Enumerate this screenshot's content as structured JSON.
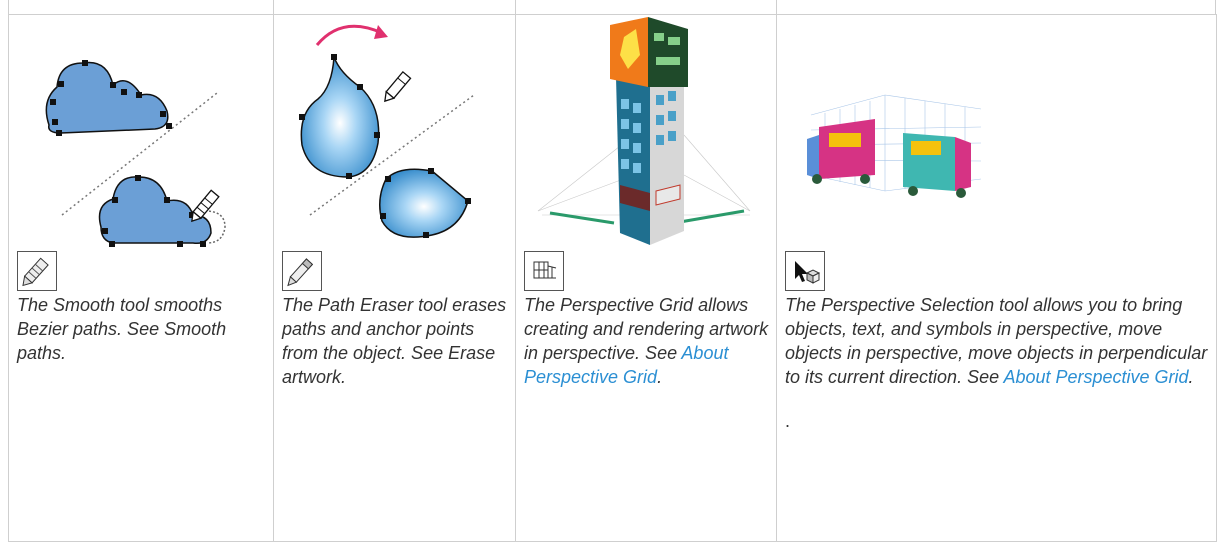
{
  "columns": [
    {
      "tool": "smooth",
      "icon": "smooth-tool-icon",
      "text": "The Smooth tool smooths Bezier paths. See Smooth paths."
    },
    {
      "tool": "path-eraser",
      "icon": "path-eraser-tool-icon",
      "text": "The Path Eraser tool erases paths and anchor points from the object. See Erase artwork."
    },
    {
      "tool": "perspective-grid",
      "icon": "perspective-grid-tool-icon",
      "text_before": "The Perspective Grid allows creating and rendering artwork in perspective. See ",
      "link": "About Perspective Grid",
      "text_after": "."
    },
    {
      "tool": "perspective-selection",
      "icon": "perspective-selection-tool-icon",
      "text_before": "The Perspective Selection tool allows you to bring objects, text, and symbols in perspective, move objects in perspective, move objects in perpendicular to its current direction. See ",
      "link": "About Perspective Grid",
      "text_after": ".",
      "trailing": "."
    }
  ],
  "colors": {
    "link": "#2b8fd3",
    "border": "#cfcfcf",
    "shape_blue": "#6b9fd6",
    "arrow_pink": "#e0306e"
  }
}
